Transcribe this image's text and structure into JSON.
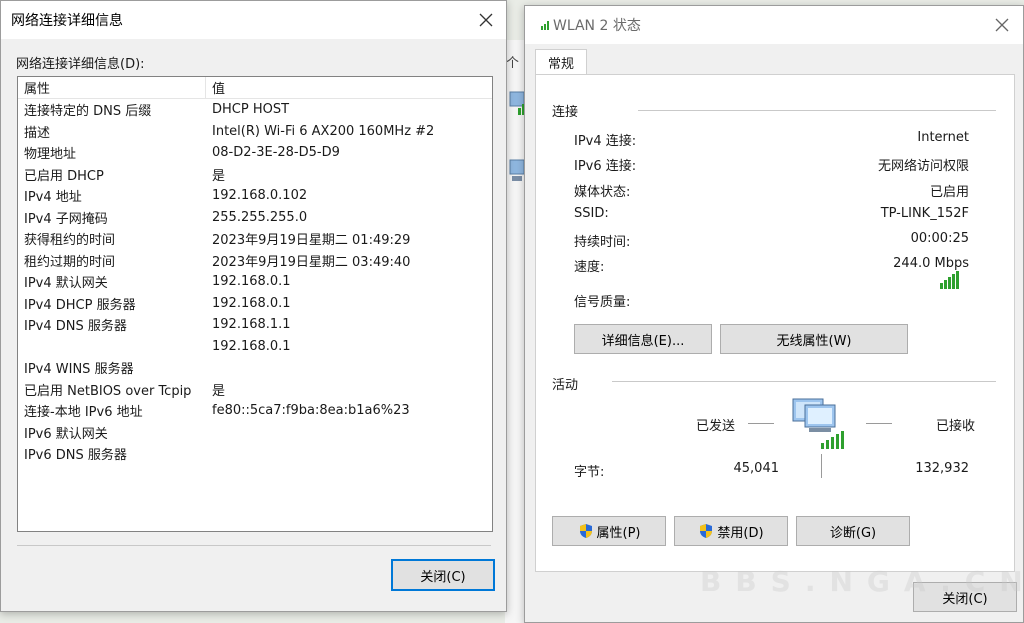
{
  "details_dialog": {
    "title": "网络连接详细信息",
    "list_label": "网络连接详细信息(D):",
    "columns": {
      "property": "属性",
      "value": "值"
    },
    "rows": [
      {
        "property": "连接特定的 DNS 后缀",
        "value": "DHCP HOST"
      },
      {
        "property": "描述",
        "value": "Intel(R) Wi-Fi 6 AX200 160MHz #2"
      },
      {
        "property": "物理地址",
        "value": "08-D2-3E-28-D5-D9"
      },
      {
        "property": "已启用 DHCP",
        "value": "是"
      },
      {
        "property": "IPv4 地址",
        "value": "192.168.0.102"
      },
      {
        "property": "IPv4 子网掩码",
        "value": "255.255.255.0"
      },
      {
        "property": "获得租约的时间",
        "value": "2023年9月19日星期二 01:49:29"
      },
      {
        "property": "租约过期的时间",
        "value": "2023年9月19日星期二 03:49:40"
      },
      {
        "property": "IPv4 默认网关",
        "value": "192.168.0.1"
      },
      {
        "property": "IPv4 DHCP 服务器",
        "value": "192.168.0.1"
      },
      {
        "property": "IPv4 DNS 服务器",
        "value": "192.168.1.1"
      },
      {
        "property": "",
        "value": "192.168.0.1"
      },
      {
        "property": "IPv4 WINS 服务器",
        "value": ""
      },
      {
        "property": "已启用 NetBIOS over Tcpip",
        "value": "是"
      },
      {
        "property": "连接-本地 IPv6 地址",
        "value": "fe80::5ca7:f9ba:8ea:b1a6%23"
      },
      {
        "property": "IPv6 默认网关",
        "value": ""
      },
      {
        "property": "IPv6 DNS 服务器",
        "value": ""
      }
    ],
    "close_button": "关闭(C)"
  },
  "background": {
    "fragment_text": "个"
  },
  "status_dialog": {
    "title": "WLAN 2 状态",
    "tab": "常规",
    "connection": {
      "group_title": "连接",
      "ipv4_label": "IPv4 连接:",
      "ipv4_value": "Internet",
      "ipv6_label": "IPv6 连接:",
      "ipv6_value": "无网络访问权限",
      "media_label": "媒体状态:",
      "media_value": "已启用",
      "ssid_label": "SSID:",
      "ssid_value": "TP-LINK_152F",
      "duration_label": "持续时间:",
      "duration_value": "00:00:25",
      "speed_label": "速度:",
      "speed_value": "244.0 Mbps",
      "signal_label": "信号质量:",
      "signal_level": 5,
      "signal_max": 5,
      "details_button": "详细信息(E)...",
      "wireless_props_button": "无线属性(W)"
    },
    "activity": {
      "group_title": "活动",
      "sent_label": "已发送",
      "received_label": "已接收",
      "bytes_label": "字节:",
      "bytes_sent": "45,041",
      "bytes_received": "132,932"
    },
    "buttons": {
      "properties": "属性(P)",
      "disable": "禁用(D)",
      "diagnose": "诊断(G)",
      "close": "关闭(C)"
    },
    "watermark": "BBS.NGA.CN"
  },
  "colors": {
    "signal_green": "#2ea02e",
    "focus_border": "#0078d7"
  },
  "icons": [
    "close-icon",
    "wifi-signal-icon",
    "network-computer-icon",
    "uac-shield-icon"
  ]
}
